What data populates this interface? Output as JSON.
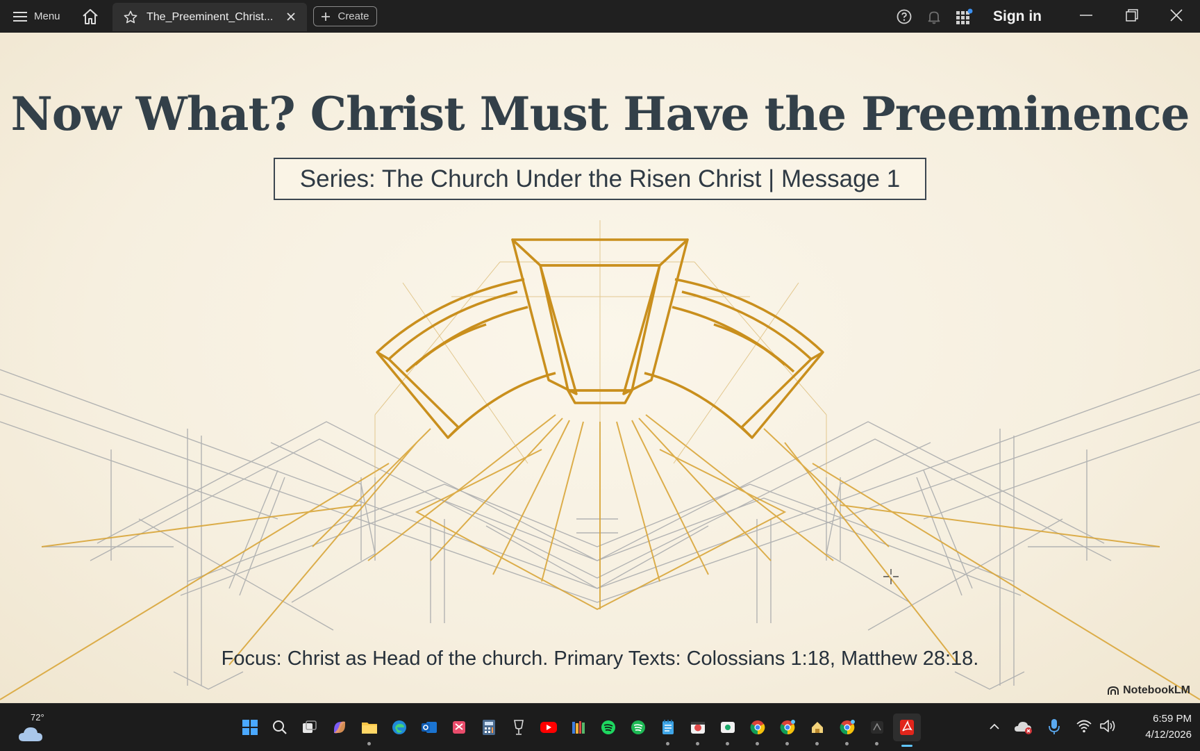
{
  "titlebar": {
    "menu_label": "Menu",
    "tab_title": "The_Preeminent_Christ...",
    "create_label": "Create",
    "sign_in_label": "Sign in"
  },
  "slide": {
    "title": "Now What? Christ Must Have the Preeminence",
    "subtitle": "Series: The Church Under the Risen Christ | Message 1",
    "focus": "Focus: Christ as Head of the church. Primary Texts: Colossians 1:18, Matthew 28:18.",
    "brand": "NotebookLM"
  },
  "taskbar": {
    "weather_temp": "72°",
    "time": "6:59 PM",
    "date": "4/12/2026",
    "pinned": [
      "start-icon",
      "search-icon",
      "task-view-icon",
      "copilot-icon",
      "file-explorer-icon",
      "edge-icon",
      "outlook-icon",
      "snipping-tool-icon",
      "calculator-icon",
      "glass-icon",
      "youtube-icon",
      "library-icon",
      "spotify-icon",
      "spotify-alt-icon",
      "notepad-icon",
      "camera-app-icon",
      "terminal-app-icon",
      "chrome-icon",
      "chrome-profile-icon",
      "files-icon",
      "chrome-alt-icon",
      "app-icon",
      "acrobat-icon"
    ]
  },
  "colors": {
    "gold": "#d6a12f",
    "title_ink": "#334049",
    "slide_bg": "#f6efdf",
    "taskbar_bg": "#1c1c1c",
    "titlebar_bg": "#202020",
    "accent_blue": "#60c5ff"
  }
}
